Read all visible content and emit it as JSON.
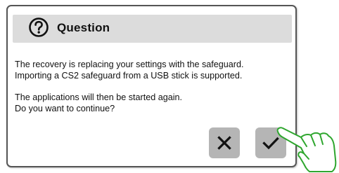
{
  "dialog": {
    "title": "Question",
    "title_icon": "question-circle-icon",
    "message_lines": [
      "The recovery is replacing your settings with the safeguard.",
      "Importing a CS2 safeguard from a USB stick is supported.",
      "The applications will then be started again.",
      "Do you want to continue?"
    ],
    "buttons": {
      "cancel_icon": "close-icon",
      "confirm_icon": "checkmark-icon"
    }
  },
  "overlay": {
    "pointer_icon": "pointing-hand-icon",
    "pointer_color": "#2ea62e"
  }
}
